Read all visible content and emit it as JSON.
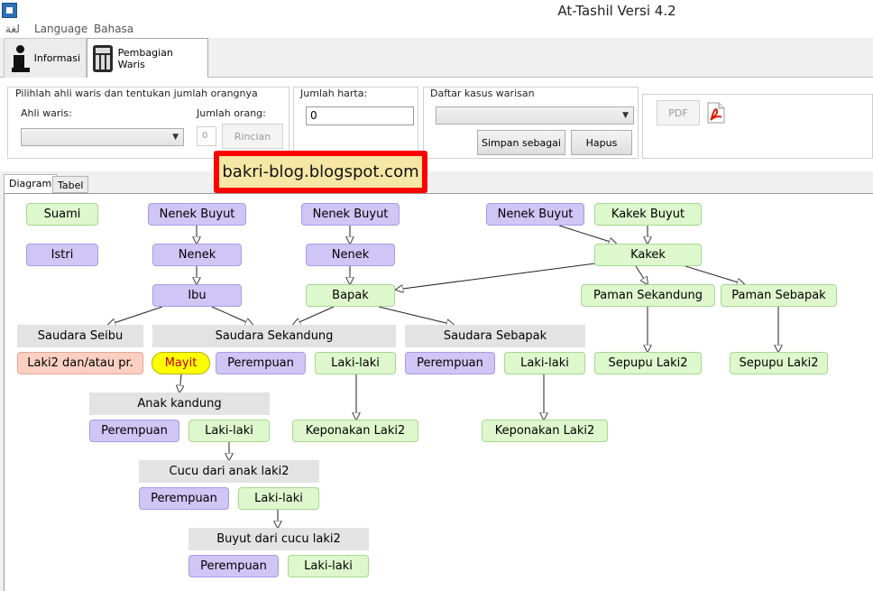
{
  "window": {
    "title": "At-Tashil Versi 4.2"
  },
  "menu": {
    "items": [
      "لغة",
      "Language",
      "Bahasa"
    ]
  },
  "toolbar": {
    "tab_informasi": "Informasi",
    "tab_pembagian": "Pembagian Waris"
  },
  "heirs_group": {
    "label": "Pilihlah ahli waris dan tentukan jumlah orangnya",
    "ahli_waris_label": "Ahli waris:",
    "ahli_waris_value": "",
    "jumlah_label": "Jumlah orang:",
    "jumlah_value": "0",
    "rincian_button": "Rincian"
  },
  "harta_group": {
    "label": "Jumlah harta:",
    "value": "0"
  },
  "kasus_group": {
    "label": "Daftar kasus warisan",
    "selected": "",
    "simpan_button": "Simpan sebagai",
    "hapus_button": "Hapus"
  },
  "export": {
    "pdf_button": "PDF",
    "pdf_icon": "pdf-file-icon"
  },
  "watermark": "bakri-blog.blogspot.com",
  "diagram_tabs": {
    "diagram": "Diagram",
    "tabel": "Tabel"
  },
  "colors": {
    "purple": "#cfc6f5",
    "green": "#def7cd",
    "peach": "#fbd0c2",
    "gray": "#e3e3e3",
    "yellow": "#ffff00"
  },
  "diagram": {
    "suami": "Suami",
    "nenek_buyut_1": "Nenek Buyut",
    "nenek_buyut_2": "Nenek Buyut",
    "nenek_buyut_3": "Nenek Buyut",
    "kakek_buyut": "Kakek Buyut",
    "istri": "Istri",
    "nenek_1": "Nenek",
    "nenek_2": "Nenek",
    "kakek": "Kakek",
    "ibu": "Ibu",
    "bapak": "Bapak",
    "paman_sekandung": "Paman Sekandung",
    "paman_sebapak": "Paman Sebapak",
    "saudara_seibu": "Saudara Seibu",
    "saudara_sekandung": "Saudara Sekandung",
    "saudara_sebapak": "Saudara Sebapak",
    "laki2_perempuan": "Laki2 dan/atau pr.",
    "mayit": "Mayit",
    "perempuan_sekandung": "Perempuan",
    "lakilaki_sekandung": "Laki-laki",
    "perempuan_sebapak": "Perempuan",
    "lakilaki_sebapak": "Laki-laki",
    "sepupu_1": "Sepupu Laki2",
    "sepupu_2": "Sepupu Laki2",
    "anak_kandung": "Anak kandung",
    "perempuan_anak": "Perempuan",
    "lakilaki_anak": "Laki-laki",
    "keponakan_1": "Keponakan Laki2",
    "keponakan_2": "Keponakan Laki2",
    "cucu": "Cucu dari anak laki2",
    "perempuan_cucu": "Perempuan",
    "lakilaki_cucu": "Laki-laki",
    "buyut": "Buyut dari cucu laki2",
    "perempuan_buyut": "Perempuan",
    "lakilaki_buyut": "Laki-laki"
  }
}
